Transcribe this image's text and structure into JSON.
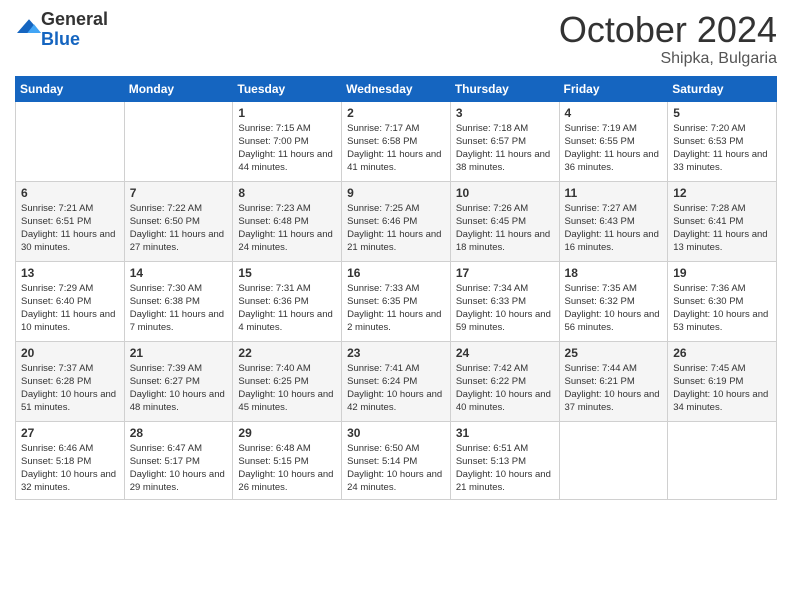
{
  "header": {
    "logo_line1": "General",
    "logo_line2": "Blue",
    "month": "October 2024",
    "location": "Shipka, Bulgaria"
  },
  "weekdays": [
    "Sunday",
    "Monday",
    "Tuesday",
    "Wednesday",
    "Thursday",
    "Friday",
    "Saturday"
  ],
  "weeks": [
    [
      {
        "day": "",
        "info": ""
      },
      {
        "day": "",
        "info": ""
      },
      {
        "day": "1",
        "info": "Sunrise: 7:15 AM\nSunset: 7:00 PM\nDaylight: 11 hours and 44 minutes."
      },
      {
        "day": "2",
        "info": "Sunrise: 7:17 AM\nSunset: 6:58 PM\nDaylight: 11 hours and 41 minutes."
      },
      {
        "day": "3",
        "info": "Sunrise: 7:18 AM\nSunset: 6:57 PM\nDaylight: 11 hours and 38 minutes."
      },
      {
        "day": "4",
        "info": "Sunrise: 7:19 AM\nSunset: 6:55 PM\nDaylight: 11 hours and 36 minutes."
      },
      {
        "day": "5",
        "info": "Sunrise: 7:20 AM\nSunset: 6:53 PM\nDaylight: 11 hours and 33 minutes."
      }
    ],
    [
      {
        "day": "6",
        "info": "Sunrise: 7:21 AM\nSunset: 6:51 PM\nDaylight: 11 hours and 30 minutes."
      },
      {
        "day": "7",
        "info": "Sunrise: 7:22 AM\nSunset: 6:50 PM\nDaylight: 11 hours and 27 minutes."
      },
      {
        "day": "8",
        "info": "Sunrise: 7:23 AM\nSunset: 6:48 PM\nDaylight: 11 hours and 24 minutes."
      },
      {
        "day": "9",
        "info": "Sunrise: 7:25 AM\nSunset: 6:46 PM\nDaylight: 11 hours and 21 minutes."
      },
      {
        "day": "10",
        "info": "Sunrise: 7:26 AM\nSunset: 6:45 PM\nDaylight: 11 hours and 18 minutes."
      },
      {
        "day": "11",
        "info": "Sunrise: 7:27 AM\nSunset: 6:43 PM\nDaylight: 11 hours and 16 minutes."
      },
      {
        "day": "12",
        "info": "Sunrise: 7:28 AM\nSunset: 6:41 PM\nDaylight: 11 hours and 13 minutes."
      }
    ],
    [
      {
        "day": "13",
        "info": "Sunrise: 7:29 AM\nSunset: 6:40 PM\nDaylight: 11 hours and 10 minutes."
      },
      {
        "day": "14",
        "info": "Sunrise: 7:30 AM\nSunset: 6:38 PM\nDaylight: 11 hours and 7 minutes."
      },
      {
        "day": "15",
        "info": "Sunrise: 7:31 AM\nSunset: 6:36 PM\nDaylight: 11 hours and 4 minutes."
      },
      {
        "day": "16",
        "info": "Sunrise: 7:33 AM\nSunset: 6:35 PM\nDaylight: 11 hours and 2 minutes."
      },
      {
        "day": "17",
        "info": "Sunrise: 7:34 AM\nSunset: 6:33 PM\nDaylight: 10 hours and 59 minutes."
      },
      {
        "day": "18",
        "info": "Sunrise: 7:35 AM\nSunset: 6:32 PM\nDaylight: 10 hours and 56 minutes."
      },
      {
        "day": "19",
        "info": "Sunrise: 7:36 AM\nSunset: 6:30 PM\nDaylight: 10 hours and 53 minutes."
      }
    ],
    [
      {
        "day": "20",
        "info": "Sunrise: 7:37 AM\nSunset: 6:28 PM\nDaylight: 10 hours and 51 minutes."
      },
      {
        "day": "21",
        "info": "Sunrise: 7:39 AM\nSunset: 6:27 PM\nDaylight: 10 hours and 48 minutes."
      },
      {
        "day": "22",
        "info": "Sunrise: 7:40 AM\nSunset: 6:25 PM\nDaylight: 10 hours and 45 minutes."
      },
      {
        "day": "23",
        "info": "Sunrise: 7:41 AM\nSunset: 6:24 PM\nDaylight: 10 hours and 42 minutes."
      },
      {
        "day": "24",
        "info": "Sunrise: 7:42 AM\nSunset: 6:22 PM\nDaylight: 10 hours and 40 minutes."
      },
      {
        "day": "25",
        "info": "Sunrise: 7:44 AM\nSunset: 6:21 PM\nDaylight: 10 hours and 37 minutes."
      },
      {
        "day": "26",
        "info": "Sunrise: 7:45 AM\nSunset: 6:19 PM\nDaylight: 10 hours and 34 minutes."
      }
    ],
    [
      {
        "day": "27",
        "info": "Sunrise: 6:46 AM\nSunset: 5:18 PM\nDaylight: 10 hours and 32 minutes."
      },
      {
        "day": "28",
        "info": "Sunrise: 6:47 AM\nSunset: 5:17 PM\nDaylight: 10 hours and 29 minutes."
      },
      {
        "day": "29",
        "info": "Sunrise: 6:48 AM\nSunset: 5:15 PM\nDaylight: 10 hours and 26 minutes."
      },
      {
        "day": "30",
        "info": "Sunrise: 6:50 AM\nSunset: 5:14 PM\nDaylight: 10 hours and 24 minutes."
      },
      {
        "day": "31",
        "info": "Sunrise: 6:51 AM\nSunset: 5:13 PM\nDaylight: 10 hours and 21 minutes."
      },
      {
        "day": "",
        "info": ""
      },
      {
        "day": "",
        "info": ""
      }
    ]
  ]
}
